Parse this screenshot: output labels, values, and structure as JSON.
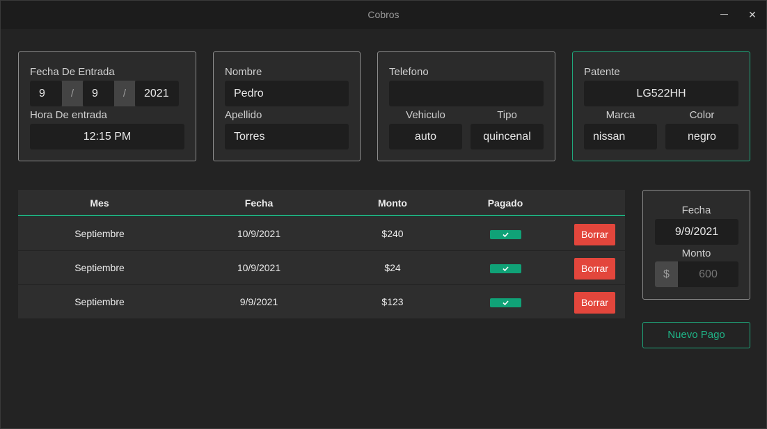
{
  "window": {
    "title": "Cobros",
    "minimize_icon": "minimize-icon",
    "close_glyph": "✕"
  },
  "entry": {
    "date_label": "Fecha De Entrada",
    "day": "9",
    "month": "9",
    "year": "2021",
    "separator": "/",
    "time_label": "Hora De entrada",
    "time": "12:15 PM"
  },
  "person": {
    "first_name_label": "Nombre",
    "first_name": "Pedro",
    "last_name_label": "Apellido",
    "last_name": "Torres"
  },
  "contact": {
    "phone_label": "Telefono",
    "phone": "",
    "vehicle_label": "Vehiculo",
    "vehicle": "auto",
    "type_label": "Tipo",
    "type": "quincenal"
  },
  "car": {
    "plate_label": "Patente",
    "plate": "LG522HH",
    "brand_label": "Marca",
    "brand": "nissan",
    "color_label": "Color",
    "color": "negro"
  },
  "payments": {
    "columns": [
      "Mes",
      "Fecha",
      "Monto",
      "Pagado"
    ],
    "delete_label": "Borrar",
    "rows": [
      {
        "month": "Septiembre",
        "date": "10/9/2021",
        "amount": "$240",
        "paid": true
      },
      {
        "month": "Septiembre",
        "date": "10/9/2021",
        "amount": "$24",
        "paid": true
      },
      {
        "month": "Septiembre",
        "date": "9/9/2021",
        "amount": "$123",
        "paid": true
      }
    ]
  },
  "new_payment": {
    "date_label": "Fecha",
    "date": "9/9/2021",
    "amount_label": "Monto",
    "currency": "$",
    "amount_placeholder": "600",
    "submit_label": "Nuevo Pago"
  },
  "colors": {
    "accent": "#1fa97c",
    "danger": "#e3463c",
    "background": "#232323",
    "card": "#2b2b2b",
    "field": "#1e1e1e"
  }
}
